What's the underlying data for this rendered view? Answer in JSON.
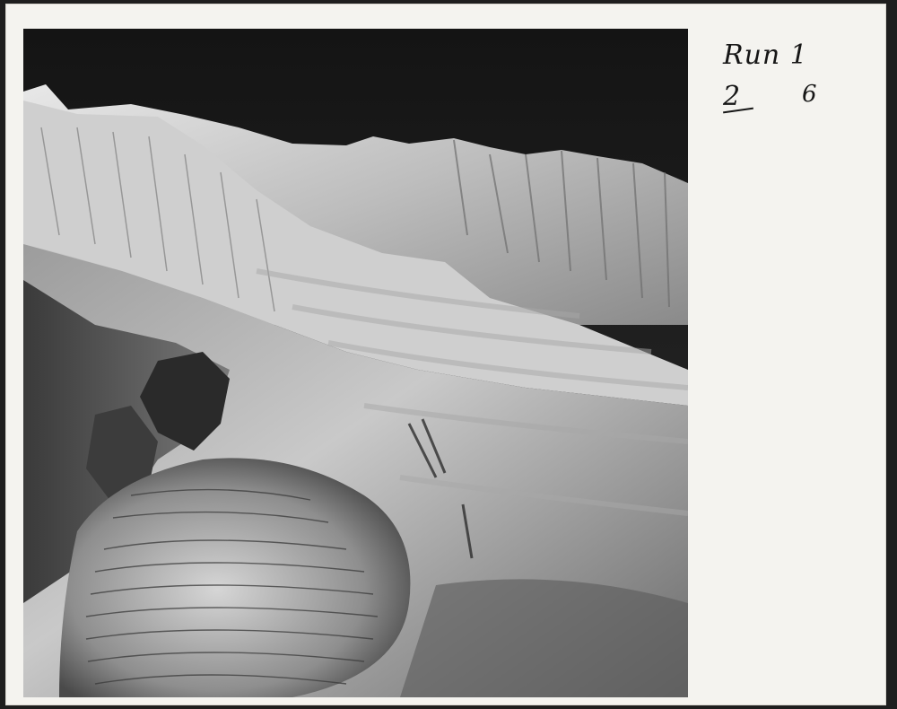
{
  "annotation": {
    "run_label": "Run 1",
    "frame_left": "2",
    "frame_right": "6"
  },
  "photo": {
    "subject": "aerial-photograph-glacier-mountains",
    "tone": "black-and-white"
  }
}
